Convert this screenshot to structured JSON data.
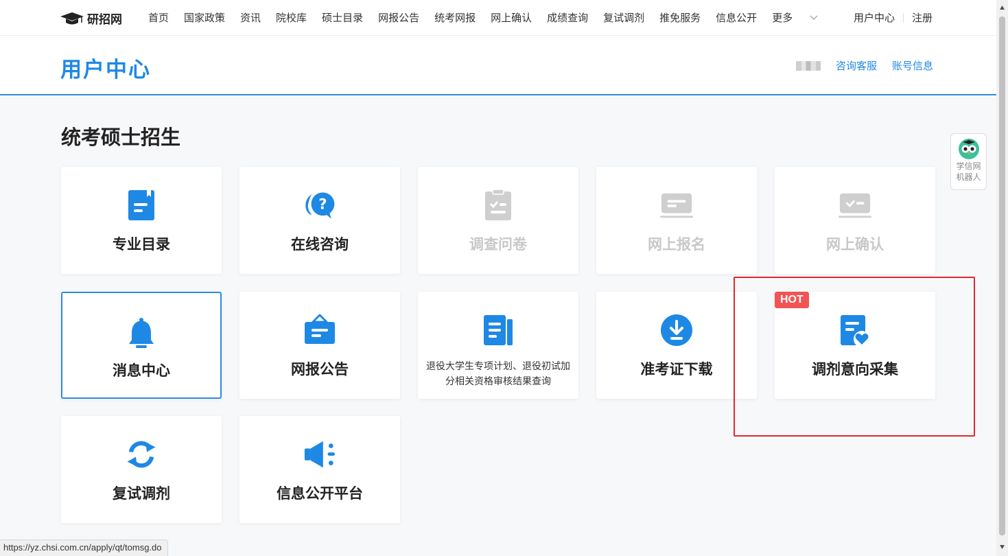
{
  "nav": {
    "logo_text": "研招网",
    "links": [
      "首页",
      "国家政策",
      "资讯",
      "院校库",
      "硕士目录",
      "网报公告",
      "统考网报",
      "网上确认",
      "成绩查询",
      "复试调剂",
      "推免服务",
      "信息公开"
    ],
    "more_label": "更多",
    "user_center": "用户中心",
    "register": "注册"
  },
  "header": {
    "title": "用户中心",
    "consult": "咨询客服",
    "account": "账号信息"
  },
  "section": {
    "title": "统考硕士招生"
  },
  "cards": [
    {
      "label": "专业目录",
      "icon": "catalog-icon",
      "disabled": false
    },
    {
      "label": "在线咨询",
      "icon": "consult-icon",
      "disabled": false
    },
    {
      "label": "调查问卷",
      "icon": "survey-icon",
      "disabled": true
    },
    {
      "label": "网上报名",
      "icon": "online-register-icon",
      "disabled": true
    },
    {
      "label": "网上确认",
      "icon": "online-confirm-icon",
      "disabled": true
    },
    {
      "label": "消息中心",
      "icon": "bell-icon",
      "disabled": false,
      "active": true
    },
    {
      "label": "网报公告",
      "icon": "announcement-icon",
      "disabled": false
    },
    {
      "label": "退役大学生专项计划、退役初试加分相关资格审核结果查询",
      "icon": "document-list-icon",
      "disabled": false
    },
    {
      "label": "准考证下载",
      "icon": "download-icon",
      "disabled": false
    },
    {
      "label": "调剂意向采集",
      "icon": "intent-collect-icon",
      "disabled": false,
      "badge": "HOT"
    },
    {
      "label": "复试调剂",
      "icon": "refresh-icon",
      "disabled": false
    },
    {
      "label": "信息公开平台",
      "icon": "megaphone-icon",
      "disabled": false
    }
  ],
  "robot": {
    "line1": "学信网",
    "line2": "机器人"
  },
  "status_url": "https://yz.chsi.com.cn/apply/qt/tomsg.do",
  "colors": {
    "accent": "#1e88e5",
    "hot": "#f25454",
    "highlight": "#e0282e",
    "disabled": "#c8c8c8"
  }
}
